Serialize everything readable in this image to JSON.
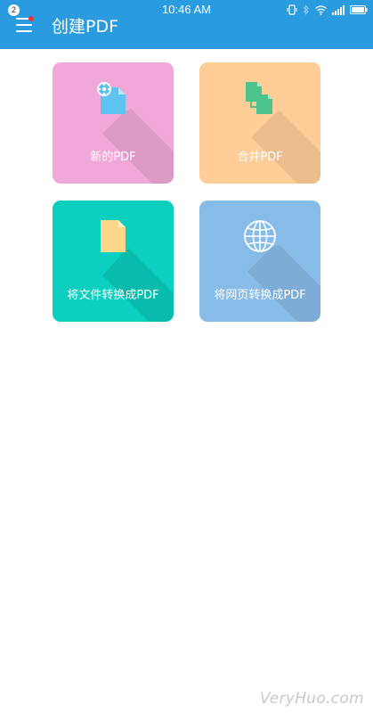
{
  "status_bar": {
    "time": "10:46 AM",
    "notification_count": "2",
    "icons": [
      "vibrate-icon",
      "bluetooth-icon",
      "wifi-icon",
      "signal-icon",
      "battery-icon"
    ]
  },
  "app_bar": {
    "title": "创建PDF",
    "color": "#2b9be0"
  },
  "cards": [
    {
      "label": "新的PDF",
      "icon": "new-document-gear-icon",
      "color": "#f0a8d8"
    },
    {
      "label": "合并PDF",
      "icon": "merge-documents-icon",
      "color": "#ffcd98"
    },
    {
      "label": "将文件转换成PDF",
      "icon": "file-document-icon",
      "color": "#0ccfbf"
    },
    {
      "label": "将网页转换成PDF",
      "icon": "globe-icon",
      "color": "#87bbe8"
    }
  ],
  "watermark": "VeryHuo.com"
}
